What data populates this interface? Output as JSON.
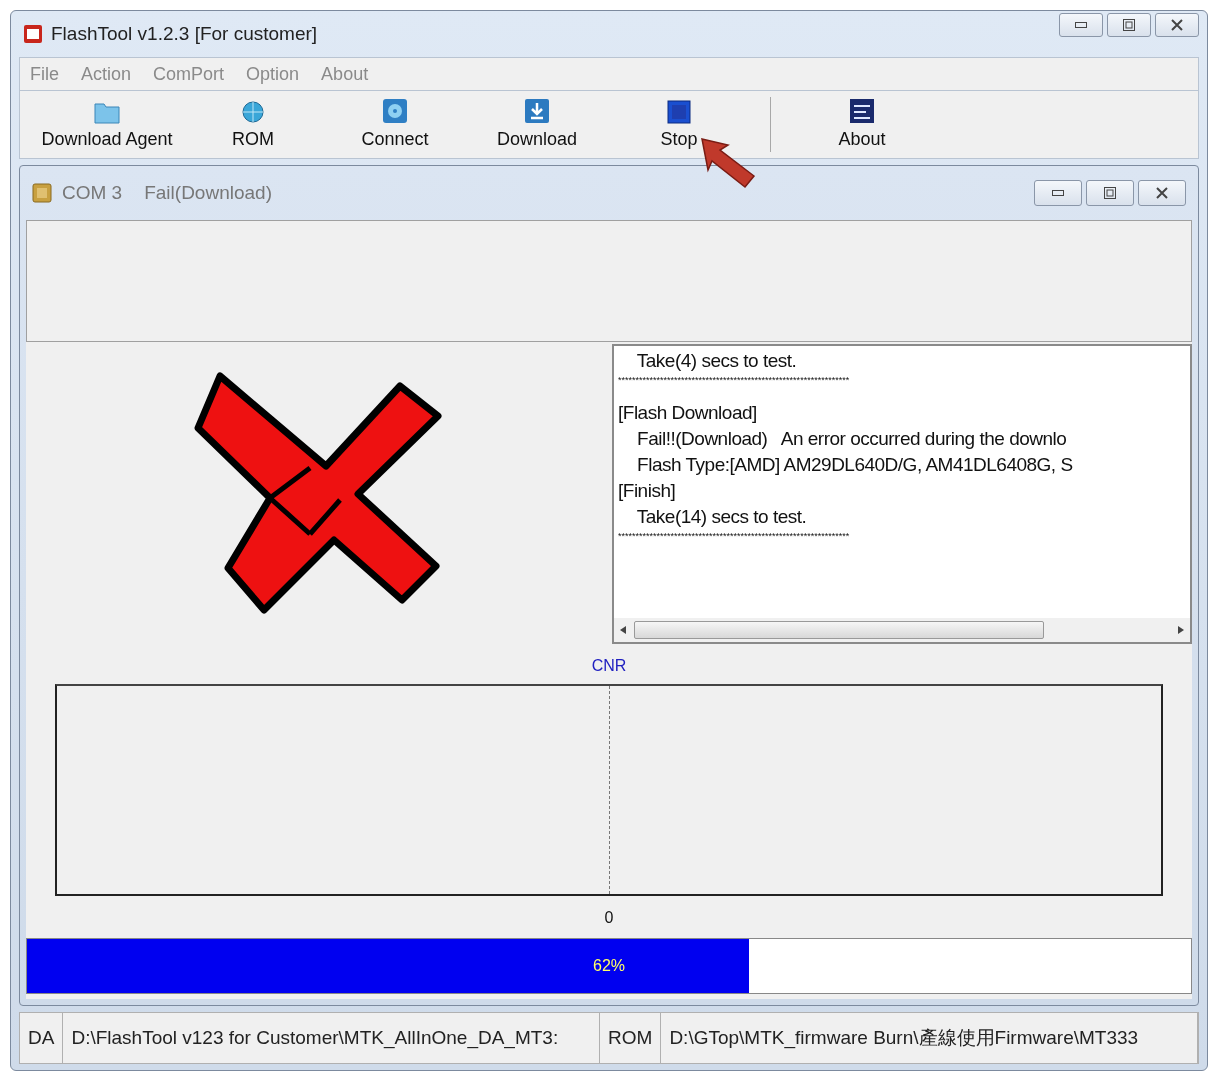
{
  "window": {
    "title": "FlashTool v1.2.3 [For customer]"
  },
  "menu": [
    "File",
    "Action",
    "ComPort",
    "Option",
    "About"
  ],
  "toolbar": [
    {
      "kind": "folder",
      "label": "Download Agent"
    },
    {
      "kind": "globe",
      "label": "ROM"
    },
    {
      "kind": "connect",
      "label": "Connect"
    },
    {
      "kind": "download",
      "label": "Download"
    },
    {
      "kind": "stop",
      "label": "Stop"
    },
    {
      "kind": "about",
      "label": "About"
    }
  ],
  "child_window": {
    "port": "COM 3",
    "status": "Fail(Download)"
  },
  "log": [
    {
      "kind": "text",
      "text": "    Take(4) secs to test."
    },
    {
      "kind": "separator",
      "text": "******************************************************************"
    },
    {
      "kind": "text",
      "text": "[Flash Download]"
    },
    {
      "kind": "text",
      "text": "    Fail!!(Download)   An error occurred during the downlo"
    },
    {
      "kind": "text",
      "text": "    Flash Type:[AMD] AM29DL640D/G, AM41DL6408G, S"
    },
    {
      "kind": "text",
      "text": "[Finish]"
    },
    {
      "kind": "text",
      "text": "    Take(14) secs to test."
    },
    {
      "kind": "separator",
      "text": "******************************************************************"
    }
  ],
  "graph": {
    "title": "CNR",
    "x_label": "0"
  },
  "progress": {
    "level": 0.62,
    "label": "62%"
  },
  "status_bar": [
    {
      "kind": "label",
      "text": "DA"
    },
    {
      "kind": "path",
      "text": "D:\\FlashTool v123 for Customer\\MTK_AllInOne_DA_MT3:"
    },
    {
      "kind": "label",
      "text": "ROM"
    },
    {
      "kind": "path",
      "text": "D:\\GTop\\MTK_firmware Burn\\產線使用Firmware\\MT333"
    }
  ]
}
